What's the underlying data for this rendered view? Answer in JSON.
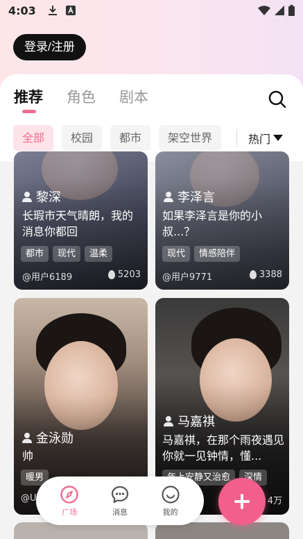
{
  "status_bar": {
    "time": "4:03"
  },
  "header": {
    "login_label": "登录/注册"
  },
  "tabs": [
    {
      "label": "推荐",
      "active": true
    },
    {
      "label": "角色",
      "active": false
    },
    {
      "label": "剧本",
      "active": false
    }
  ],
  "filters": {
    "chips": [
      {
        "label": "全部",
        "active": true
      },
      {
        "label": "校园",
        "active": false
      },
      {
        "label": "都市",
        "active": false
      },
      {
        "label": "架空世界",
        "active": false
      }
    ],
    "sort_label": "热门"
  },
  "cards": [
    {
      "name": "黎深",
      "desc": "长瑕市天气晴朗，我的消息你都回",
      "tags": [
        "都市",
        "现代",
        "温柔"
      ],
      "author": "@用户6189",
      "count": "5203"
    },
    {
      "name": "李泽言",
      "desc": "如果李泽言是你的小叔...？",
      "tags": [
        "现代",
        "情感陪伴"
      ],
      "author": "@用户9771",
      "count": "3388"
    },
    {
      "name": "金泳勋",
      "desc": "帅",
      "tags": [
        "暖男"
      ],
      "author": "@U",
      "count": ""
    },
    {
      "name": "马嘉祺",
      "desc": "马嘉祺，在那个雨夜遇见你就一见钟情，懂...",
      "tags": [
        "年上安静又治愈",
        "深情"
      ],
      "author": "",
      "count": "4万"
    }
  ],
  "nav": [
    {
      "label": "广场",
      "icon": "compass-icon",
      "active": true
    },
    {
      "label": "消息",
      "icon": "chat-icon",
      "active": false
    },
    {
      "label": "我的",
      "icon": "smile-icon",
      "active": false
    }
  ],
  "colors": {
    "accent": "#ef6f93",
    "fab": "#f25f8c",
    "dark_button": "#111111"
  }
}
